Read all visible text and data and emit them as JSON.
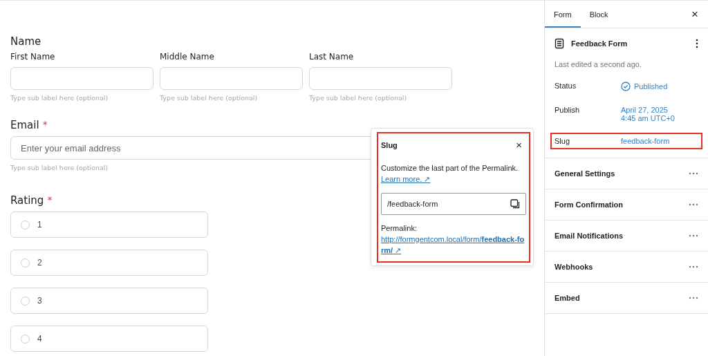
{
  "form": {
    "name_field": {
      "label": "Name",
      "parts": [
        {
          "label": "First Name",
          "sublabel": "Type sub label here (optional)"
        },
        {
          "label": "Middle Name",
          "sublabel": "Type sub label here (optional)"
        },
        {
          "label": "Last Name",
          "sublabel": "Type sub label here (optional)"
        }
      ]
    },
    "email_field": {
      "label": "Email",
      "required_mark": "*",
      "placeholder": "Enter your email address",
      "sublabel": "Type sub label here (optional)"
    },
    "rating_field": {
      "label": "Rating",
      "required_mark": "*",
      "options": [
        {
          "label": "1",
          "selected": false
        },
        {
          "label": "2",
          "selected": false
        },
        {
          "label": "3",
          "selected": false
        },
        {
          "label": "4",
          "selected": false
        }
      ]
    }
  },
  "slug_popover": {
    "title": "Slug",
    "close": "×",
    "description": "Customize the last part of the Permalink.",
    "learn_more": "Learn more. ↗",
    "value": "/feedback-form",
    "permalink_label": "Permalink:",
    "permalink": "http://formgentcom.local/form/**feedback-form/** ↗",
    "highlighted": true
  },
  "sidebar": {
    "tabs": [
      {
        "label": "Form",
        "selected": true
      },
      {
        "label": "Block",
        "selected": false
      }
    ],
    "close": "×",
    "title": "Feedback Form",
    "subtitle": "Last edited a second ago.",
    "rows": [
      {
        "label": "Status",
        "value": "Published",
        "kind": "status",
        "highlighted": false
      },
      {
        "label": "Publish",
        "value": "April 27, 2025\n4:45 am UTC+0",
        "kind": "text",
        "highlighted": false
      },
      {
        "label": "Slug",
        "value": "feedback-form",
        "kind": "text",
        "highlighted": true
      }
    ],
    "sections": [
      {
        "label": "General Settings"
      },
      {
        "label": "Form Confirmation"
      },
      {
        "label": "Email Notifications"
      },
      {
        "label": "Webhooks"
      },
      {
        "label": "Embed"
      }
    ]
  }
}
